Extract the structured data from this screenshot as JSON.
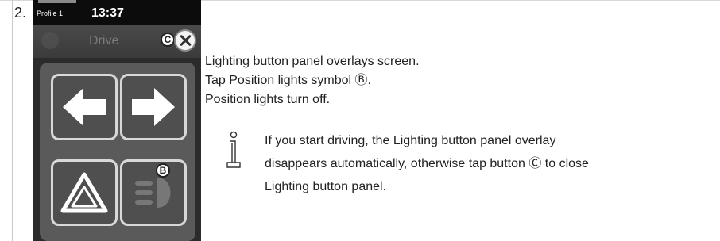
{
  "step_number": "2.",
  "device": {
    "status": {
      "profile": "Profile 1",
      "time": "13:37"
    },
    "title": "Drive",
    "callouts": {
      "close": "C",
      "position_lights": "B"
    },
    "icons": [
      "arrow-left-icon",
      "arrow-right-icon",
      "hazard-warning-icon",
      "position-lights-icon",
      "close-icon"
    ]
  },
  "instructions": [
    "Lighting button panel overlays screen.",
    "Tap Position lights symbol Ⓑ.",
    "Position lights turn off."
  ],
  "note": {
    "lines": [
      "If you start driving, the Lighting button panel overlay",
      "disappears automatically, otherwise tap button Ⓒ to close",
      "Lighting button panel."
    ]
  }
}
